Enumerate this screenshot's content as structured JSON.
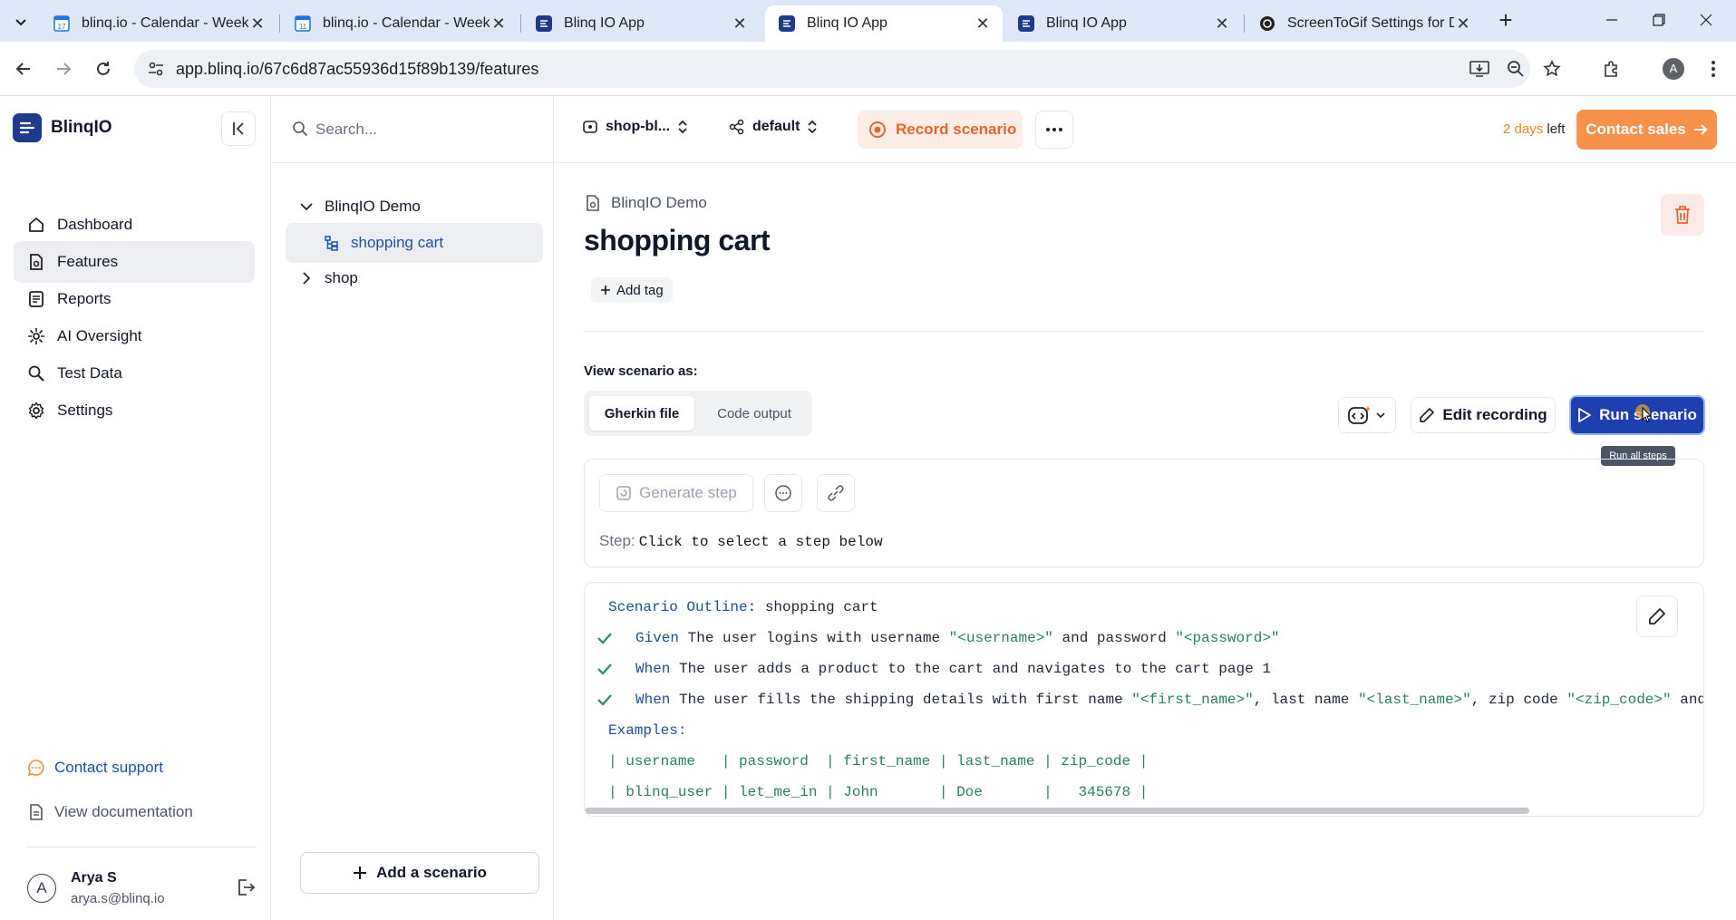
{
  "browser": {
    "tabs": [
      {
        "title": "blinq.io - Calendar - Week",
        "icon": "calendar-17-icon"
      },
      {
        "title": "blinq.io - Calendar - Week",
        "icon": "calendar-11-icon"
      },
      {
        "title": "Blinq IO App",
        "icon": "blinq-favicon"
      },
      {
        "title": "Blinq IO App",
        "icon": "blinq-favicon"
      },
      {
        "title": "Blinq IO App",
        "icon": "blinq-favicon"
      },
      {
        "title": "ScreenToGif Settings for De",
        "icon": "screentogif-favicon"
      }
    ],
    "active_tab": 3,
    "url": "app.blinq.io/67c6d87ac55936d15f89b139/features",
    "profile_initial": "A"
  },
  "sidebar": {
    "brand": "BlinqIO",
    "items": [
      {
        "label": "Dashboard",
        "icon": "home-icon"
      },
      {
        "label": "Features",
        "icon": "features-icon"
      },
      {
        "label": "Reports",
        "icon": "reports-icon"
      },
      {
        "label": "AI Oversight",
        "icon": "ai-oversight-icon"
      },
      {
        "label": "Test Data",
        "icon": "test-data-icon"
      },
      {
        "label": "Settings",
        "icon": "gear-icon"
      }
    ],
    "active_item": 1,
    "contact_support": "Contact support",
    "view_documentation": "View documentation",
    "user": {
      "initial": "A",
      "name": "Arya S",
      "email": "arya.s@blinq.io"
    }
  },
  "tree": {
    "search_placeholder": "Search...",
    "folder": "BlinqIO Demo",
    "selected_feature": "shopping cart",
    "collapsed_folder": "shop",
    "add_scenario": "Add a scenario"
  },
  "topbar": {
    "project": "shop-bl...",
    "environment": "default",
    "record_label": "Record scenario",
    "trial_number": "2 days",
    "trial_suffix": "left",
    "contact_sales": "Contact sales"
  },
  "feature": {
    "breadcrumb": "BlinqIO Demo",
    "title": "shopping cart",
    "add_tag": "Add tag",
    "view_as_label": "View scenario as:",
    "view_modes": [
      "Gherkin file",
      "Code output"
    ],
    "active_view": 0,
    "edit_recording": "Edit recording",
    "run_scenario": "Run scenario",
    "run_tooltip": "Run all steps",
    "generate_step": "Generate step",
    "step_label": "Step:",
    "step_value": "Click to select a step below"
  },
  "gherkin": {
    "outline_kw": "Scenario Outline",
    "outline_name": ": shopping cart",
    "steps": [
      {
        "kw": "Given",
        "text_1": " The user logins with username ",
        "s1": "\"<username>\"",
        "text_2": " and password ",
        "s2": "\"<password>\"",
        "rest": "",
        "passed": true
      },
      {
        "kw": "When",
        "text_1": " The user adds a product to the cart and navigates to the cart page 1",
        "s1": "",
        "text_2": "",
        "s2": "",
        "rest": "",
        "passed": true
      },
      {
        "kw": "When",
        "text_1": " The user fills the shipping details with first name ",
        "s1": "\"<first_name>\"",
        "text_2": ", last name ",
        "s2": "\"<last_name>\"",
        "rest": ", zip code ",
        "s3": "\"<zip_code>\"",
        "tail": " and",
        "passed": true
      }
    ],
    "examples_kw": "Examples:",
    "table_header": "| username   | password  | first_name | last_name | zip_code |",
    "table_row": "| blinq_user | let_me_in | John       | Doe       |   345678 |"
  }
}
